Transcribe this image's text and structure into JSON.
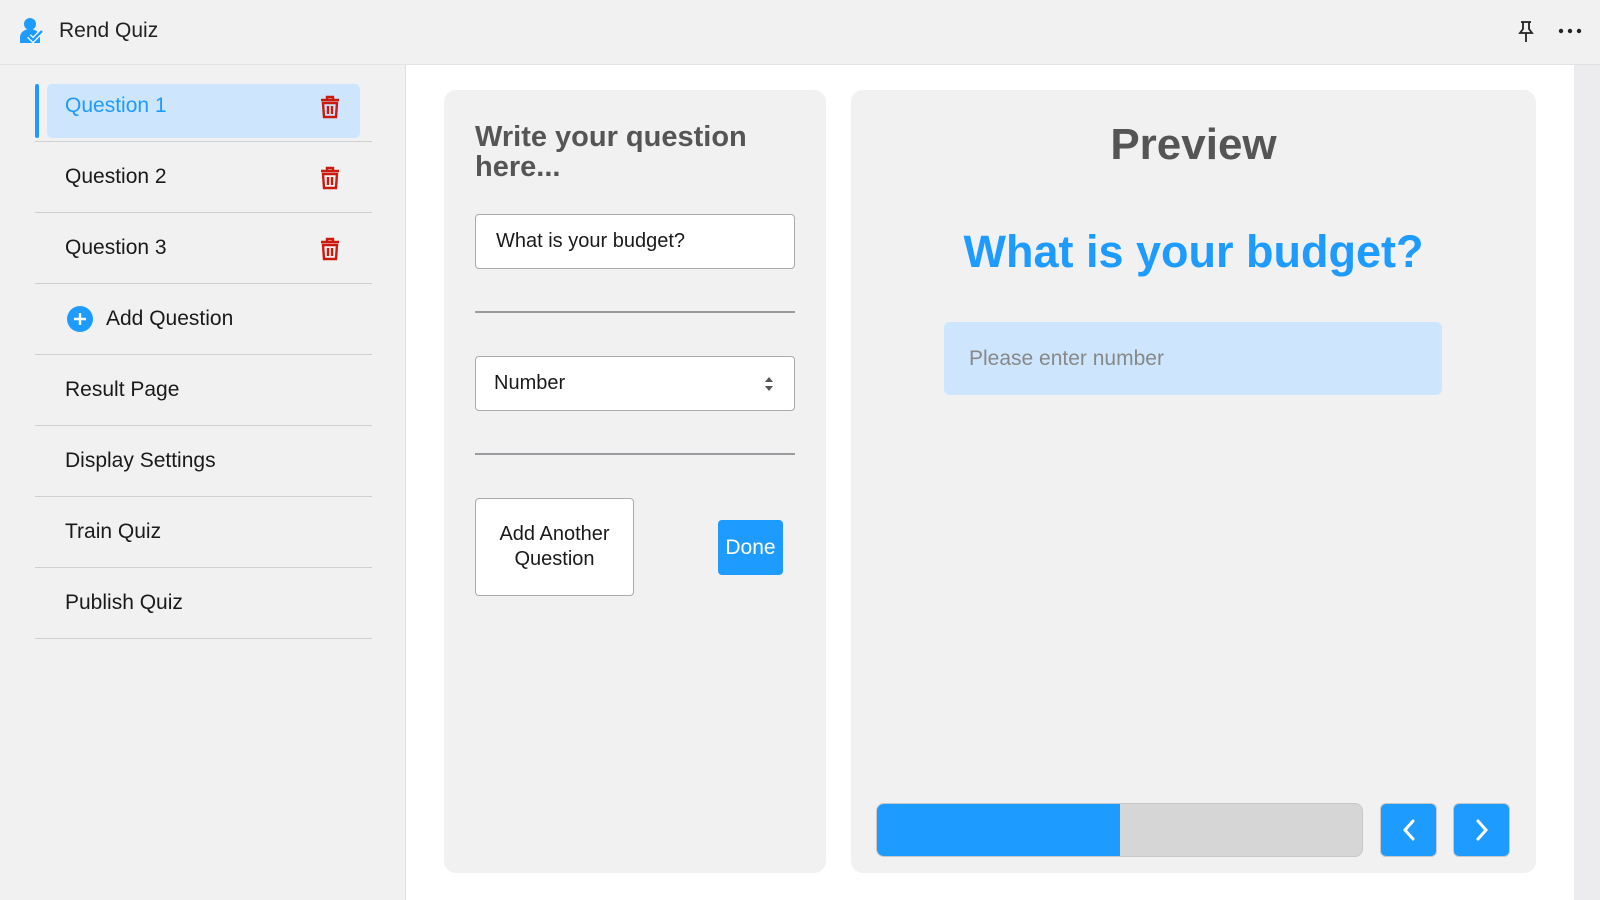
{
  "app": {
    "title": "Rend Quiz",
    "icon": "person-check-icon"
  },
  "header": {
    "pin_icon": "pin-icon",
    "more_icon": "more-horizontal-icon"
  },
  "sidebar": {
    "items": [
      {
        "label": "Question 1",
        "active": true,
        "deletable": true
      },
      {
        "label": "Question 2",
        "deletable": true
      },
      {
        "label": "Question 3",
        "deletable": true
      },
      {
        "label": "Add Question",
        "icon": "plus-circle-icon"
      },
      {
        "label": "Result Page"
      },
      {
        "label": "Display Settings"
      },
      {
        "label": "Train Quiz"
      },
      {
        "label": "Publish Quiz"
      }
    ]
  },
  "editor": {
    "title": "Write your question here...",
    "question_value": "What is your budget?",
    "type_value": "Number",
    "add_another_label": "Add Another Question",
    "done_label": "Done"
  },
  "preview": {
    "title": "Preview",
    "question": "What is your budget?",
    "input_placeholder": "Please enter number",
    "progress_percent": 50
  },
  "colors": {
    "accent": "#1e9bff",
    "highlight": "#cde6fd",
    "delete": "#cc1a0e"
  }
}
